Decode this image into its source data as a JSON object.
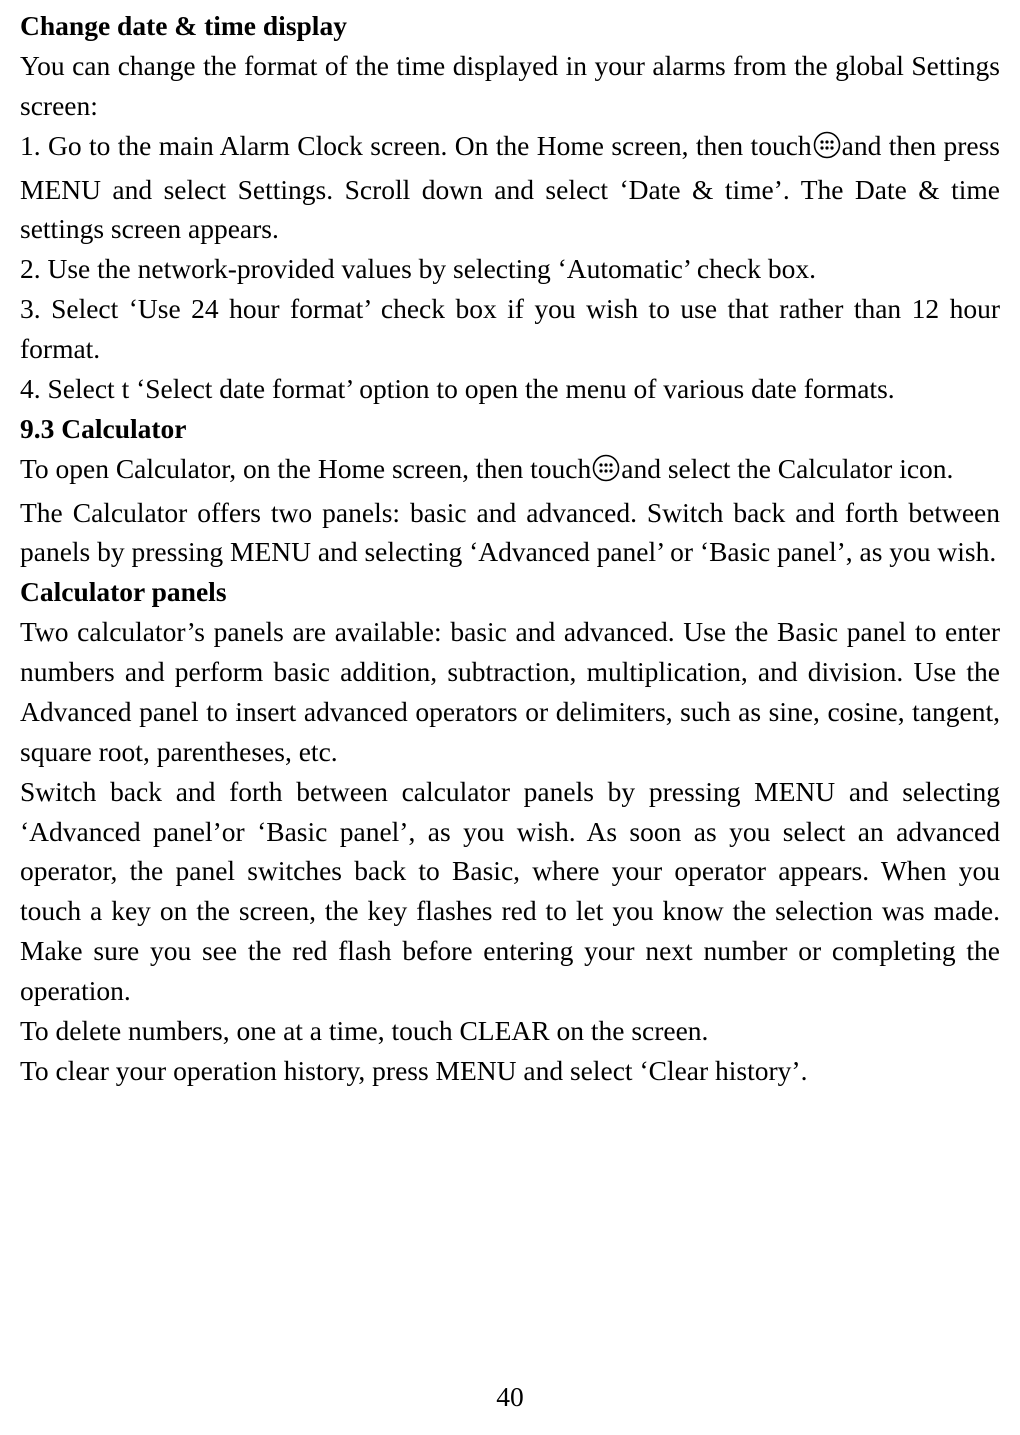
{
  "h1": "Change date & time display",
  "p1": "You can change the format of the time displayed in your alarms from the global Settings screen:",
  "step1a": "1. Go to the main Alarm Clock screen. On the Home screen, then touch",
  "step1b": "and then press MENU and select Settings. Scroll down and select ‘Date & time’. The Date & time settings screen appears.",
  "step2": "2. Use the network-provided values by selecting ‘Automatic’ check box.",
  "step3": "3. Select ‘Use 24 hour format’ check box if you wish to use that rather than 12 hour format.",
  "step4": "4. Select t ‘Select date format’ option to open the menu of various date formats.",
  "h2": "9.3 Calculator",
  "calc1a": "To open Calculator, on the Home screen, then touch",
  "calc1b": "and select the Calculator icon.",
  "calc2": "The Calculator offers two panels: basic and advanced. Switch back and forth between panels by pressing MENU and selecting ‘Advanced panel’ or ‘Basic panel’, as you wish.",
  "h3": "Calculator panels",
  "cp1": "Two calculator’s panels are available: basic and advanced. Use the Basic panel to enter numbers and perform basic addition, subtraction, multiplication, and division. Use the Advanced panel to insert advanced operators or delimiters, such as sine, cosine, tangent, square root, parentheses, etc.",
  "cp2": "Switch back and forth between calculator panels by pressing MENU and selecting ‘Advanced panel’or ‘Basic panel’, as you wish. As soon as you select an advanced operator, the panel switches back to Basic, where your operator appears. When you touch a key on the screen, the key flashes red to let you know the selection was made. Make sure you see the red flash before entering your next number or completing the operation.",
  "cp3": "To delete numbers, one at a time, touch CLEAR on the screen.",
  "cp4": "To clear your operation history, press MENU and select ‘Clear history’.",
  "page_number": "40",
  "icons": {
    "apps": "apps-icon"
  }
}
